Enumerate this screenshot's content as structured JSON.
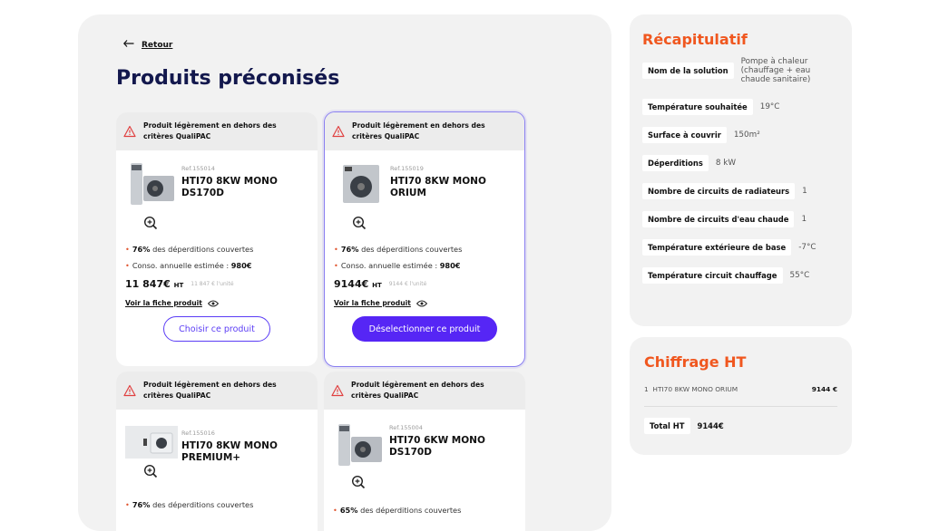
{
  "nav": {
    "back_label": "Retour"
  },
  "page_title": "Produits préconisés",
  "cards": [
    {
      "warning": "Produit légèrement en dehors des critères QualiPAC",
      "ref": "Ref.155014",
      "name": "HTI70 8KW MONO DS170D",
      "coverage_pct": "76%",
      "coverage_text": "des déperditions couvertes",
      "conso_label": "Conso. annuelle estimée :",
      "conso_value": "980€",
      "price": "11 847€",
      "price_suffix": "HT",
      "unit_price": "11 847 € l'unité",
      "fiche_label": "Voir la fiche produit",
      "button_label": "Choisir ce produit",
      "selected": false
    },
    {
      "warning": "Produit légèrement en dehors des critères QualiPAC",
      "ref": "Ref.155019",
      "name": "HTI70 8KW MONO ORIUM",
      "coverage_pct": "76%",
      "coverage_text": "des déperditions couvertes",
      "conso_label": "Conso. annuelle estimée :",
      "conso_value": "980€",
      "price": "9144€",
      "price_suffix": "HT",
      "unit_price": "9144 € l'unité",
      "fiche_label": "Voir la fiche produit",
      "button_label": "Déselectionner ce produit",
      "selected": true
    },
    {
      "warning": "Produit légèrement en dehors des critères QualiPAC",
      "ref": "Ref.155016",
      "name": "HTI70 8KW MONO PREMIUM+",
      "coverage_pct": "76%",
      "coverage_text": "des déperditions couvertes"
    },
    {
      "warning": "Produit légèrement en dehors des critères QualiPAC",
      "ref": "Ref.155004",
      "name": "HTI70 6KW MONO DS170D",
      "coverage_pct": "65%",
      "coverage_text": "des déperditions couvertes"
    }
  ],
  "recap": {
    "title": "Récapitulatif",
    "rows": [
      {
        "label": "Nom de la solution",
        "value": "Pompe à chaleur (chauffage + eau chaude sanitaire)"
      },
      {
        "label": "Température souhaitée",
        "value": "19°C"
      },
      {
        "label": "Surface à couvrir",
        "value": "150m²"
      },
      {
        "label": "Déperditions",
        "value": "8 kW"
      },
      {
        "label": "Nombre de circuits de radiateurs",
        "value": "1"
      },
      {
        "label": "Nombre de circuits d'eau chaude",
        "value": "1"
      },
      {
        "label": "Température extérieure de base",
        "value": "-7°C"
      },
      {
        "label": "Température circuit chauffage",
        "value": "55°C"
      }
    ]
  },
  "chiffrage": {
    "title": "Chiffrage HT",
    "line_qty": "1",
    "line_name": "HTI70 8KW MONO ORIUM",
    "line_amount": "9144 €",
    "total_label": "Total HT",
    "total_value": "9144€"
  },
  "colors": {
    "accent": "#f0571f",
    "primary": "#5626f5",
    "title": "#13184d",
    "warning": "#e04040"
  }
}
